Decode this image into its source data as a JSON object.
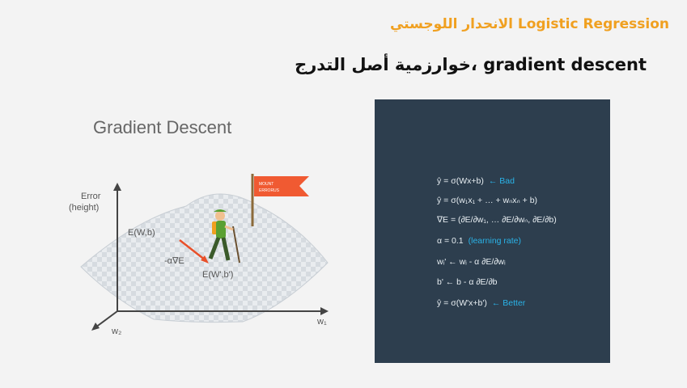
{
  "header": {
    "title_ar_en": "الانحدار اللوجستي  Logistic Regression",
    "subtitle_ar_en": "خوارزمية أصل التدرج، gradient descent"
  },
  "figure": {
    "title": "Gradient Descent",
    "y_axis_label_1": "Error",
    "y_axis_label_2": "(height)",
    "point_start": "E(W,b)",
    "step_label": "-α∇E",
    "point_end": "E(W',b')",
    "axis_w1": "w₁",
    "axis_w2": "w₂",
    "flag_text_1": "MOUNT",
    "flag_text_2": "ERRORUS"
  },
  "equations": [
    {
      "text": "ŷ = σ(Wx+b)",
      "note": "← Bad"
    },
    {
      "text": "ŷ = σ(w₁x₁ + … + wₙxₙ + b)",
      "note": ""
    },
    {
      "text": "∇E = (∂E/∂w₁, … ∂E/∂wₙ, ∂E/∂b)",
      "note": ""
    },
    {
      "text": "α = 0.1",
      "note": "(learning rate)"
    },
    {
      "text": "wᵢ' ← wᵢ - α ∂E/∂wᵢ",
      "note": ""
    },
    {
      "text": "b' ← b - α ∂E/∂b",
      "note": ""
    },
    {
      "text": "ŷ = σ(W'x+b')",
      "note": "← Better"
    }
  ],
  "colors": {
    "title_accent": "#f0a020",
    "panel_bg": "#2d3e4e",
    "note_blue": "#2ab3e8",
    "flag": "#f05a32",
    "hiker_green": "#5aa032"
  }
}
